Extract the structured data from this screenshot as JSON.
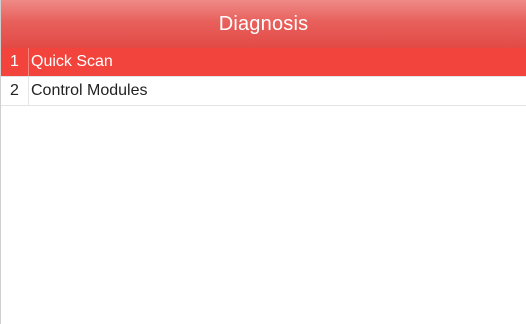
{
  "header": {
    "title": "Diagnosis"
  },
  "colors": {
    "header": "#e8605c",
    "selected": "#f2443c"
  },
  "menu": {
    "items": [
      {
        "number": "1",
        "label": "Quick Scan",
        "selected": true
      },
      {
        "number": "2",
        "label": "Control Modules",
        "selected": false
      }
    ]
  }
}
